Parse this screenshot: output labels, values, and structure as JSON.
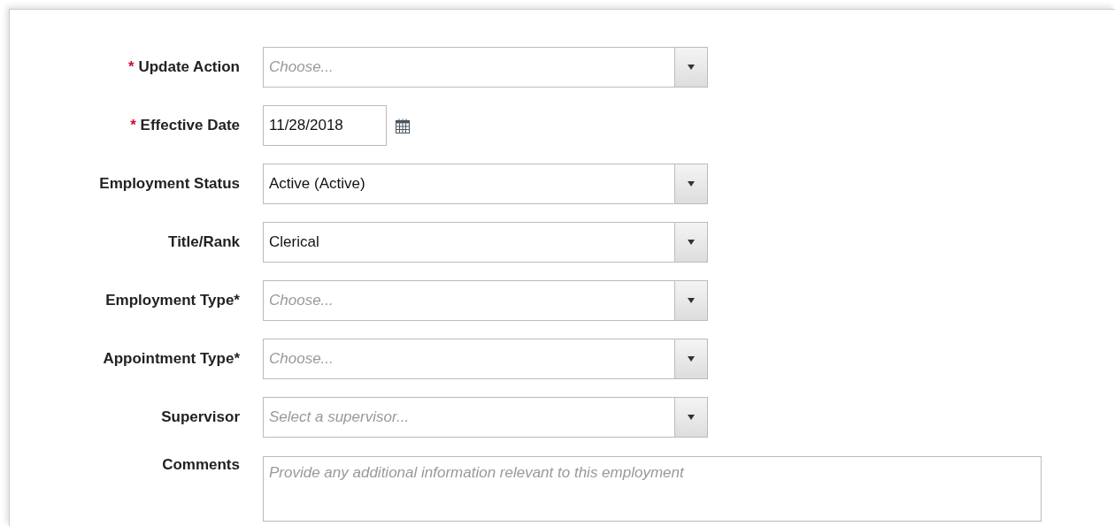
{
  "fields": [
    {
      "kind": "select",
      "label": "Update Action",
      "required_mark": "*",
      "placeholder": "Choose..."
    },
    {
      "kind": "date",
      "label": "Effective Date",
      "required_mark": "*",
      "value": "11/28/2018"
    },
    {
      "kind": "select",
      "label": "Employment Status",
      "value": "Active (Active)"
    },
    {
      "kind": "select",
      "label": "Title/Rank",
      "value": "Clerical"
    },
    {
      "kind": "select",
      "label": "Employment Type*",
      "placeholder": "Choose..."
    },
    {
      "kind": "select",
      "label": "Appointment Type*",
      "placeholder": "Choose..."
    },
    {
      "kind": "select",
      "label": "Supervisor",
      "placeholder": "Select a supervisor..."
    },
    {
      "kind": "textarea",
      "label": "Comments",
      "placeholder": "Provide any additional information relevant to this employment"
    }
  ]
}
